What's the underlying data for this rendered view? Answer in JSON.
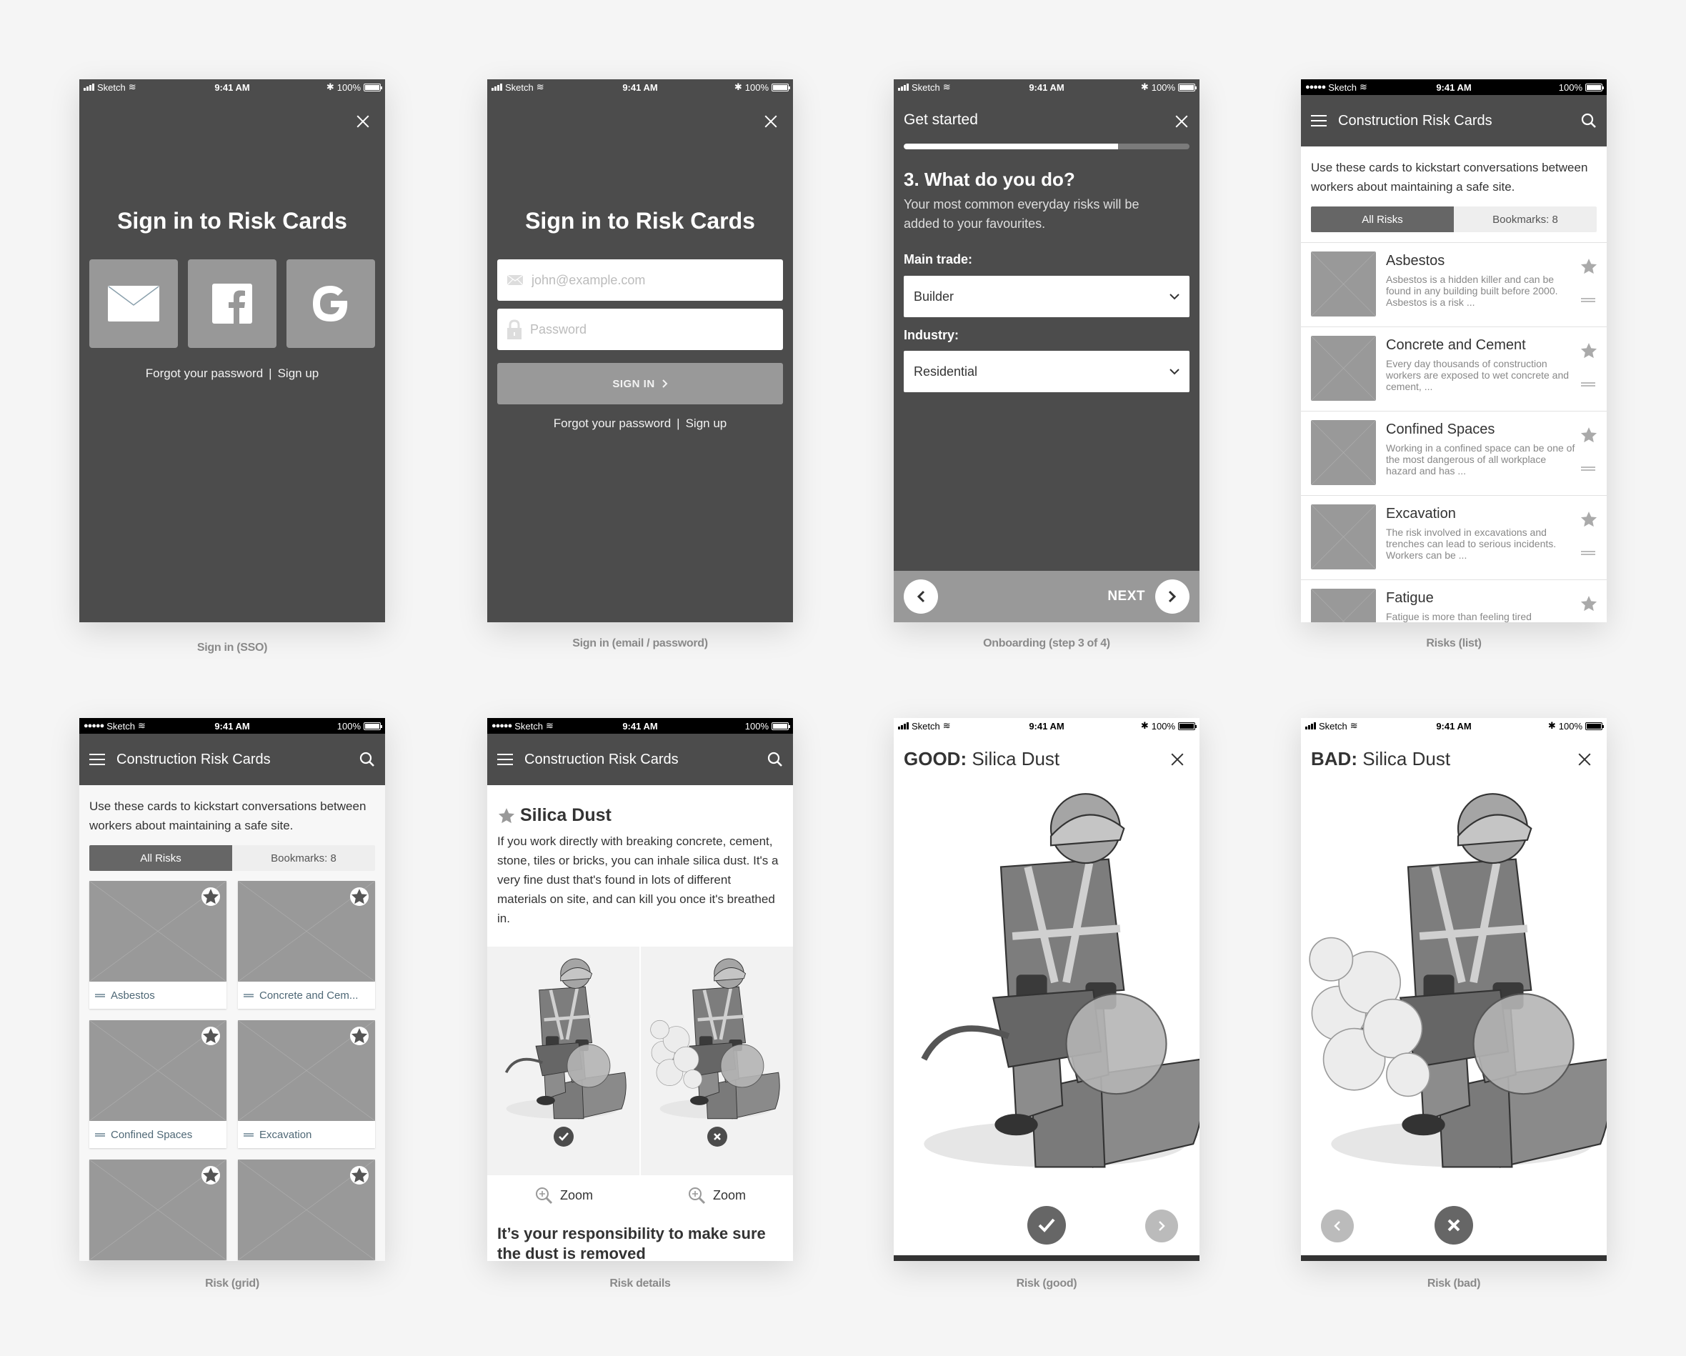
{
  "status_bar": {
    "carrier": "Sketch",
    "time": "9:41 AM",
    "battery": "100%"
  },
  "screens": {
    "sso": {
      "caption": "Sign in (SSO)",
      "title": "Sign in to Risk Cards",
      "providers": [
        "email-icon",
        "facebook-icon",
        "google-icon"
      ],
      "forgot": "Forgot your password",
      "separator": "|",
      "signup": "Sign up"
    },
    "email": {
      "caption": "Sign in (email / password)",
      "title": "Sign in to Risk Cards",
      "email_placeholder": "john@example.com",
      "password_placeholder": "Password",
      "signin_button": "SIGN IN",
      "forgot": "Forgot your password",
      "separator": "|",
      "signup": "Sign up"
    },
    "onboarding": {
      "caption": "Onboarding (step 3 of 4)",
      "title": "Get started",
      "progress_percent": 75,
      "question": "3. What do you do?",
      "subtitle": "Your most common everyday risks will be added to your favourites.",
      "trade_label": "Main trade:",
      "trade_value": "Builder",
      "industry_label": "Industry:",
      "industry_value": "Residential",
      "next_label": "NEXT"
    },
    "list": {
      "caption": "Risks (list)",
      "app_title": "Construction Risk Cards",
      "intro": "Use these cards to kickstart conversations between workers about maintaining a safe site.",
      "tabs": [
        "All Risks",
        "Bookmarks: 8"
      ],
      "items": [
        {
          "title": "Asbestos",
          "desc": "Asbestos is a hidden killer and can be found in any building built before 2000. Asbestos is a risk ..."
        },
        {
          "title": "Concrete and Cement",
          "desc": "Every day thousands of construction workers are exposed to wet concrete and cement, ..."
        },
        {
          "title": "Confined Spaces",
          "desc": "Working in a confined space can be one of the most dangerous of all workplace hazard and has ..."
        },
        {
          "title": "Excavation",
          "desc": "The risk involved in excavations and trenches can lead to serious incidents. Workers can be ..."
        },
        {
          "title": "Fatigue",
          "desc": "Fatigue is more than feeling tired"
        }
      ]
    },
    "grid": {
      "caption": "Risk (grid)",
      "app_title": "Construction Risk Cards",
      "intro": "Use these cards to kickstart conversations between workers about maintaining a safe site.",
      "tabs": [
        "All Risks",
        "Bookmarks: 8"
      ],
      "items": [
        "Asbestos",
        "Concrete and Cem...",
        "Confined Spaces",
        "Excavation",
        "",
        ""
      ]
    },
    "details": {
      "caption": "Risk details",
      "app_title": "Construction Risk Cards",
      "title": "Silica Dust",
      "body": "If you work directly with breaking concrete, cement, stone, tiles or bricks, you can inhale silica dust. It's a very fine dust that's found in lots of different materials on site, and can kill you once it's breathed in.",
      "zoom_label": "Zoom",
      "responsibility": "It’s your responsibility to make sure the dust is removed"
    },
    "good": {
      "caption": "Risk (good)",
      "prefix": "GOOD:",
      "title": "Silica Dust"
    },
    "bad": {
      "caption": "Risk (bad)",
      "prefix": "BAD:",
      "title": "Silica Dust"
    }
  },
  "colors": {
    "dark_surface": "#4c4c4c",
    "button_gray": "#999999",
    "page_bg": "#f5f5f5",
    "label_slate": "#4f6876"
  }
}
